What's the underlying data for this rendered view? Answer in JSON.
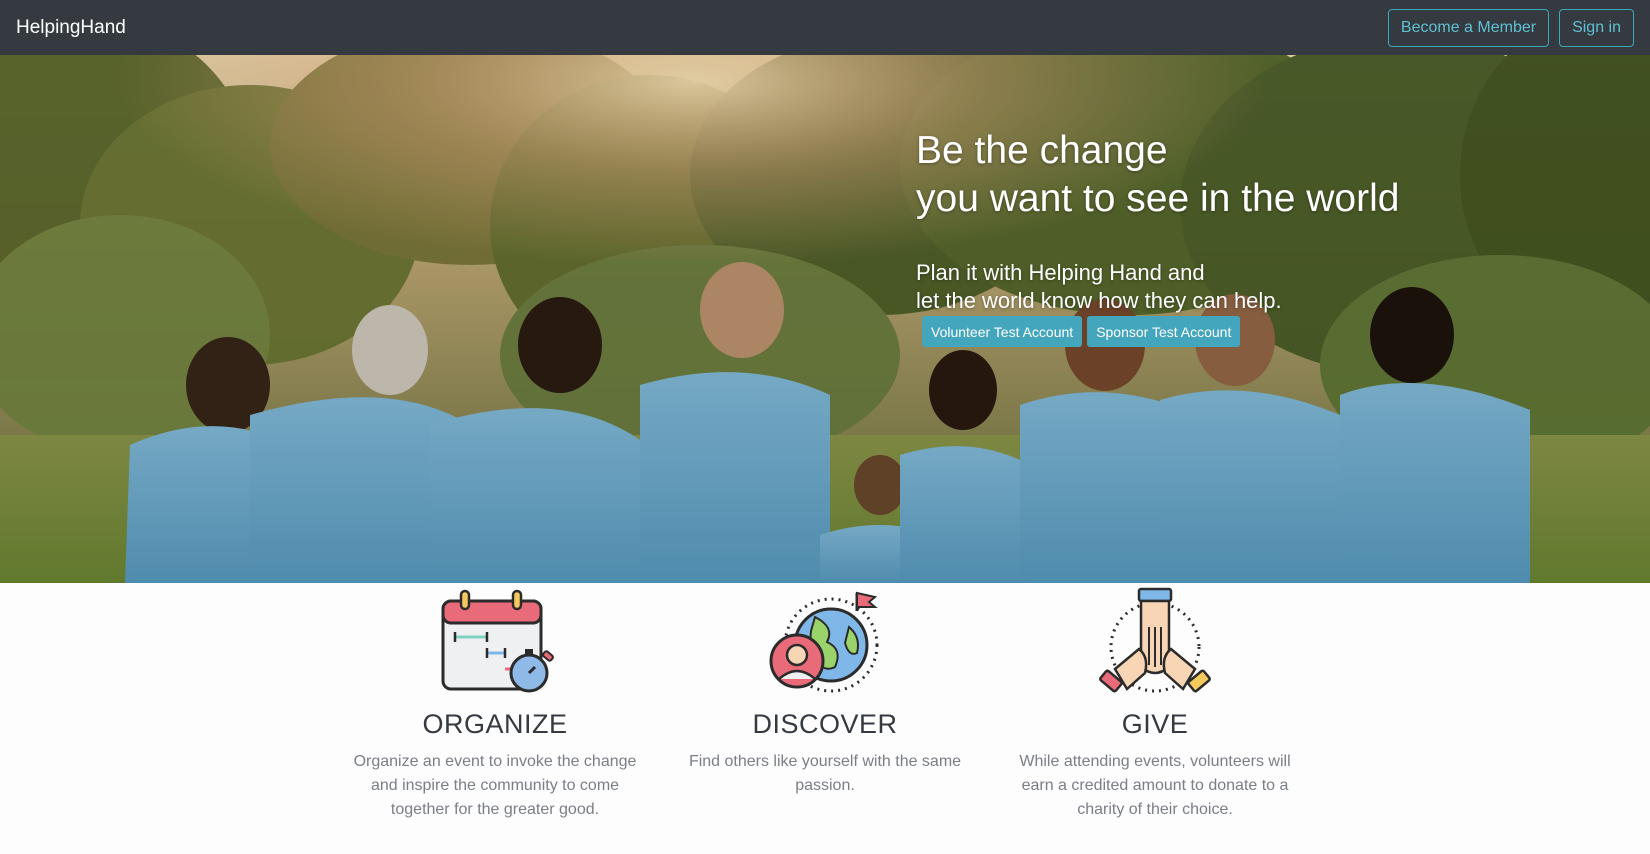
{
  "navbar": {
    "brand": "HelpingHand",
    "become_member_label": "Become a Member",
    "sign_in_label": "Sign in"
  },
  "hero": {
    "headline_line1": "Be the change",
    "headline_line2": "you want to see in the world",
    "subline_line1": "Plan it with Helping Hand and",
    "subline_line2": "let the world know how they can help.",
    "volunteer_button": "Volunteer Test Account",
    "sponsor_button": "Sponsor Test Account"
  },
  "features": [
    {
      "icon": "calendar-stopwatch-icon",
      "title": "ORGANIZE",
      "desc_lines": [
        "Organize an event to invoke the change",
        "and inspire the community to come",
        "together for the greater good."
      ]
    },
    {
      "icon": "globe-person-flag-icon",
      "title": "DISCOVER",
      "desc_lines": [
        "Find others like yourself with the same",
        "passion."
      ]
    },
    {
      "icon": "stacked-hands-icon",
      "title": "GIVE",
      "desc_lines": [
        "While attending events, volunteers will",
        "earn a credited amount to donate to a",
        "charity of their choice."
      ]
    }
  ],
  "colors": {
    "navbar_bg": "#343a40",
    "accent_info": "#17a2b8",
    "shirt_blue": "#6fb3d6"
  }
}
